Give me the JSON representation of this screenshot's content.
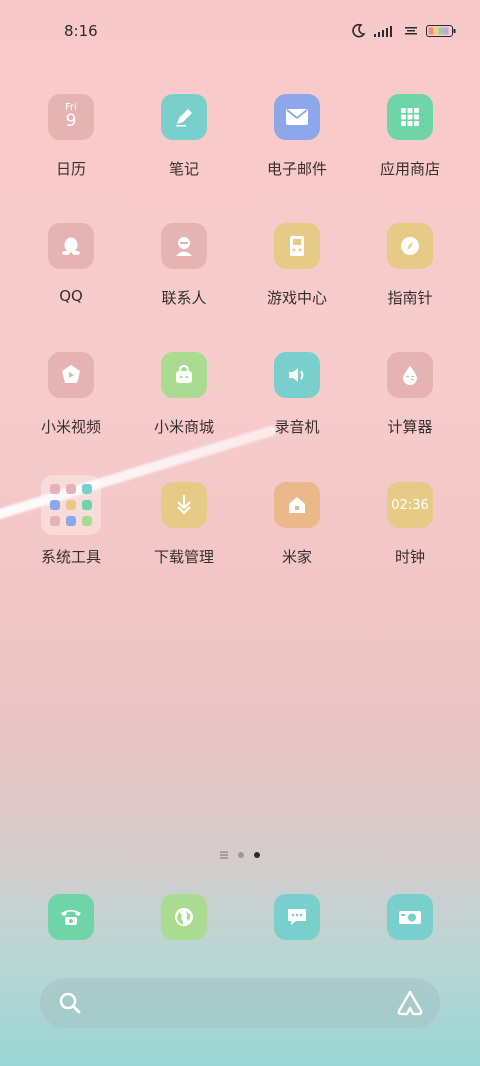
{
  "status_bar": {
    "time": "8:16",
    "icons": [
      "moon-icon",
      "signal-icon",
      "wifi-icon",
      "battery-icon"
    ]
  },
  "apps": [
    {
      "label": "日历",
      "icon": "calendar-icon",
      "color": "#e6b3b3",
      "tile_line1": "Fri",
      "tile_line2": "9"
    },
    {
      "label": "笔记",
      "icon": "pen-icon",
      "color": "#79cfcc"
    },
    {
      "label": "电子邮件",
      "icon": "mail-icon",
      "color": "#8ca7ea"
    },
    {
      "label": "应用商店",
      "icon": "grid-icon",
      "color": "#6fd5a9"
    },
    {
      "label": "QQ",
      "icon": "penguin-icon",
      "color": "#e6b3b3"
    },
    {
      "label": "联系人",
      "icon": "person-icon",
      "color": "#e6b3b3"
    },
    {
      "label": "游戏中心",
      "icon": "gamepad-icon",
      "color": "#e5cb85"
    },
    {
      "label": "指南针",
      "icon": "compass-icon",
      "color": "#e5cb85"
    },
    {
      "label": "小米视频",
      "icon": "play-icon",
      "color": "#e6b3b3"
    },
    {
      "label": "小米商城",
      "icon": "bag-icon",
      "color": "#a9dc90"
    },
    {
      "label": "录音机",
      "icon": "speaker-icon",
      "color": "#79cfcc"
    },
    {
      "label": "计算器",
      "icon": "calculator-icon",
      "color": "#e6b3b3"
    },
    {
      "label": "系统工具",
      "icon": "folder-icon",
      "color": "#ffffff"
    },
    {
      "label": "下载管理",
      "icon": "download-icon",
      "color": "#e5cb85"
    },
    {
      "label": "米家",
      "icon": "home-icon",
      "color": "#ebb88a"
    },
    {
      "label": "时钟",
      "icon": "clock-icon",
      "color": "#e5cb85",
      "tile_text": "02:36"
    }
  ],
  "page_indicator": {
    "pages": 3,
    "current": 3
  },
  "dock": [
    {
      "icon": "phone-icon",
      "color": "#6fd5a9"
    },
    {
      "icon": "browser-icon",
      "color": "#a9dc90"
    },
    {
      "icon": "message-icon",
      "color": "#79cfcc"
    },
    {
      "icon": "camera-icon",
      "color": "#79cfcc"
    }
  ],
  "search": {
    "icon": "search-icon",
    "assistant_icon": "assistant-icon"
  }
}
